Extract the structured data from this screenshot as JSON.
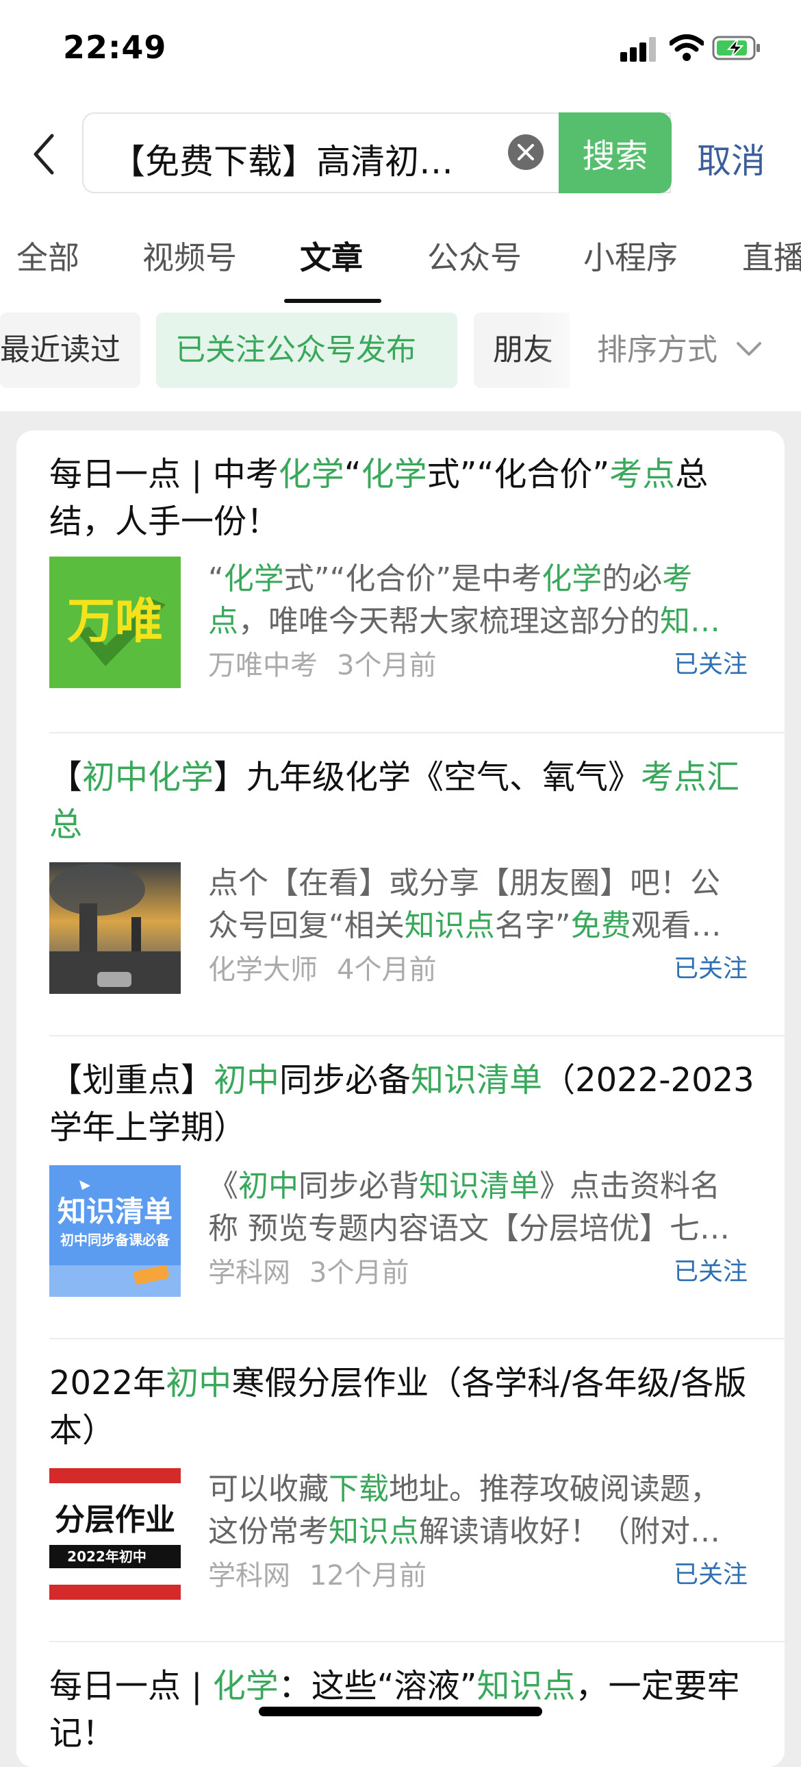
{
  "status_bar": {
    "time": "22:49"
  },
  "search": {
    "query": "【免费下载】高清初…",
    "button_label": "搜索",
    "cancel_label": "取消"
  },
  "tabs": [
    {
      "label": "全部"
    },
    {
      "label": "视频号"
    },
    {
      "label": "文章",
      "active": true
    },
    {
      "label": "公众号"
    },
    {
      "label": "小程序"
    },
    {
      "label": "直播"
    }
  ],
  "filters": [
    {
      "label": "最近读过"
    },
    {
      "label": "已关注公众号发布",
      "active": true
    },
    {
      "label": "朋友"
    }
  ],
  "sort_label": "排序方式",
  "colors": {
    "accent": "#3aa85b",
    "search_button": "#55bf6e",
    "link": "#2f6fb3",
    "cancel": "#3b5e9a"
  },
  "results": [
    {
      "title": [
        "每日一点 | 中考",
        "化学",
        "“",
        "化学",
        "式”“化合价”",
        "考点",
        "总结，人手一份！"
      ],
      "snippet_lines": [
        [
          "“",
          "化学",
          "式”“化合价”是中考",
          "化学",
          "的必",
          "考"
        ],
        [
          "点",
          "，唯唯今天帮大家梳理这部分的",
          "知…"
        ]
      ],
      "thumb_text": "万唯",
      "source": "万唯中考",
      "time": "3个月前",
      "follow": "已关注"
    },
    {
      "title": [
        "【",
        "初中化学",
        "】九年级化学《空气、氧气》",
        "考点汇总"
      ],
      "snippet_lines": [
        [
          "点个【在看】或分享【朋友圈】吧！公"
        ],
        [
          "众号回复“相关",
          "知识点",
          "名字”",
          "免费",
          "观看…"
        ]
      ],
      "source": "化学大师",
      "time": "4个月前",
      "follow": "已关注"
    },
    {
      "title": [
        "【划重点】",
        "初中",
        "同步必备",
        "知识清单",
        "（2022-2023学年上学期）"
      ],
      "snippet_lines": [
        [
          "《",
          "初中",
          "同步必背",
          "知识清单",
          "》点击资料名"
        ],
        [
          "称 预览专题内容语文【分层培优】七…"
        ]
      ],
      "thumb_text": "知识清单",
      "thumb_subtext": "初中同步备课必备",
      "source": "学科网",
      "time": "3个月前",
      "follow": "已关注"
    },
    {
      "title": [
        "2022年",
        "初中",
        "寒假分层作业（各学科/各年级/各版本）"
      ],
      "snippet_lines": [
        [
          "可以收藏",
          "下载",
          "地址。推荐攻破阅读题，"
        ],
        [
          "这份常考",
          "知识点",
          "解读请收好！（附对…"
        ]
      ],
      "thumb_text": "分层作业",
      "thumb_subtext": "2022年初中",
      "source": "学科网",
      "time": "12个月前",
      "follow": "已关注"
    },
    {
      "title": [
        "每日一点 | ",
        "化学",
        "：这些“溶液”",
        "知识点",
        "，一定要牢记！"
      ]
    }
  ]
}
